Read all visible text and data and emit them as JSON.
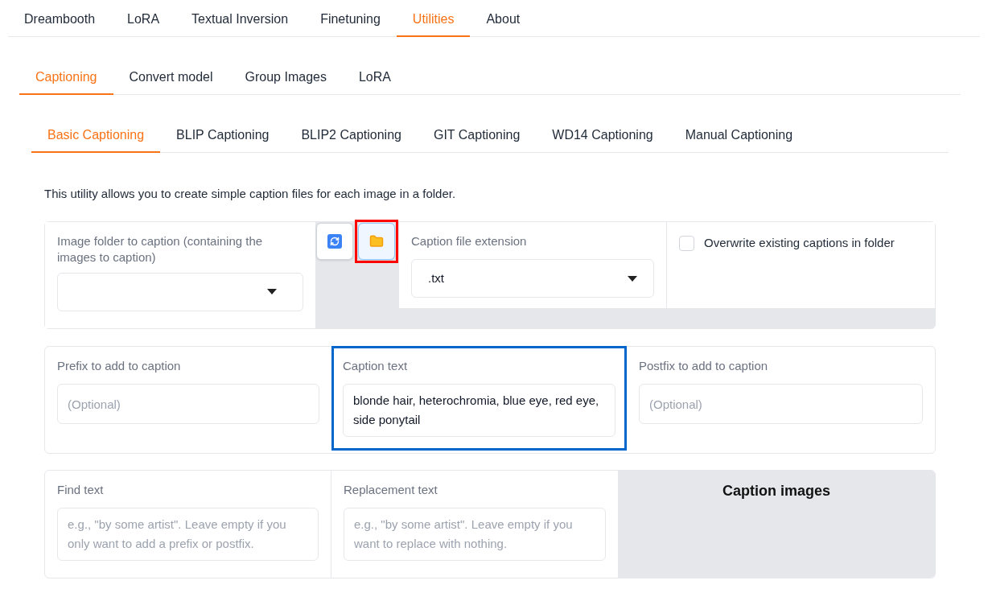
{
  "main_tabs": [
    {
      "label": "Dreambooth",
      "selected": false
    },
    {
      "label": "LoRA",
      "selected": false
    },
    {
      "label": "Textual Inversion",
      "selected": false
    },
    {
      "label": "Finetuning",
      "selected": false
    },
    {
      "label": "Utilities",
      "selected": true
    },
    {
      "label": "About",
      "selected": false
    }
  ],
  "utility_tabs": [
    {
      "label": "Captioning",
      "selected": true
    },
    {
      "label": "Convert model",
      "selected": false
    },
    {
      "label": "Group Images",
      "selected": false
    },
    {
      "label": "LoRA",
      "selected": false
    }
  ],
  "caption_tabs": [
    {
      "label": "Basic Captioning",
      "selected": true
    },
    {
      "label": "BLIP Captioning",
      "selected": false
    },
    {
      "label": "BLIP2 Captioning",
      "selected": false
    },
    {
      "label": "GIT Captioning",
      "selected": false
    },
    {
      "label": "WD14 Captioning",
      "selected": false
    },
    {
      "label": "Manual Captioning",
      "selected": false
    }
  ],
  "description": "This utility allows you to create simple caption files for each image in a folder.",
  "image_folder": {
    "label": "Image folder to caption (containing the images to caption)"
  },
  "folder_buttons": [
    {
      "kind": "refresh",
      "highlighted": false
    },
    {
      "kind": "folder",
      "highlighted": true
    }
  ],
  "extension": {
    "label": "Caption file extension",
    "value": ".txt"
  },
  "overwrite": {
    "label": "Overwrite existing captions in folder",
    "checked": false
  },
  "prefix": {
    "label": "Prefix to add to caption",
    "placeholder": "(Optional)"
  },
  "caption_text": {
    "label": "Caption text",
    "value": "blonde hair, heterochromia, blue eye, red eye, side ponytail",
    "highlighted": true
  },
  "postfix": {
    "label": "Postfix to add to caption",
    "placeholder": "(Optional)"
  },
  "find": {
    "label": "Find text",
    "placeholder": "e.g., \"by some artist\". Leave empty if you only want to add a prefix or postfix."
  },
  "replacement": {
    "label": "Replacement text",
    "placeholder": "e.g., \"by some artist\". Leave empty if you want to replace with nothing."
  },
  "caption_button": {
    "label": "Caption images"
  }
}
